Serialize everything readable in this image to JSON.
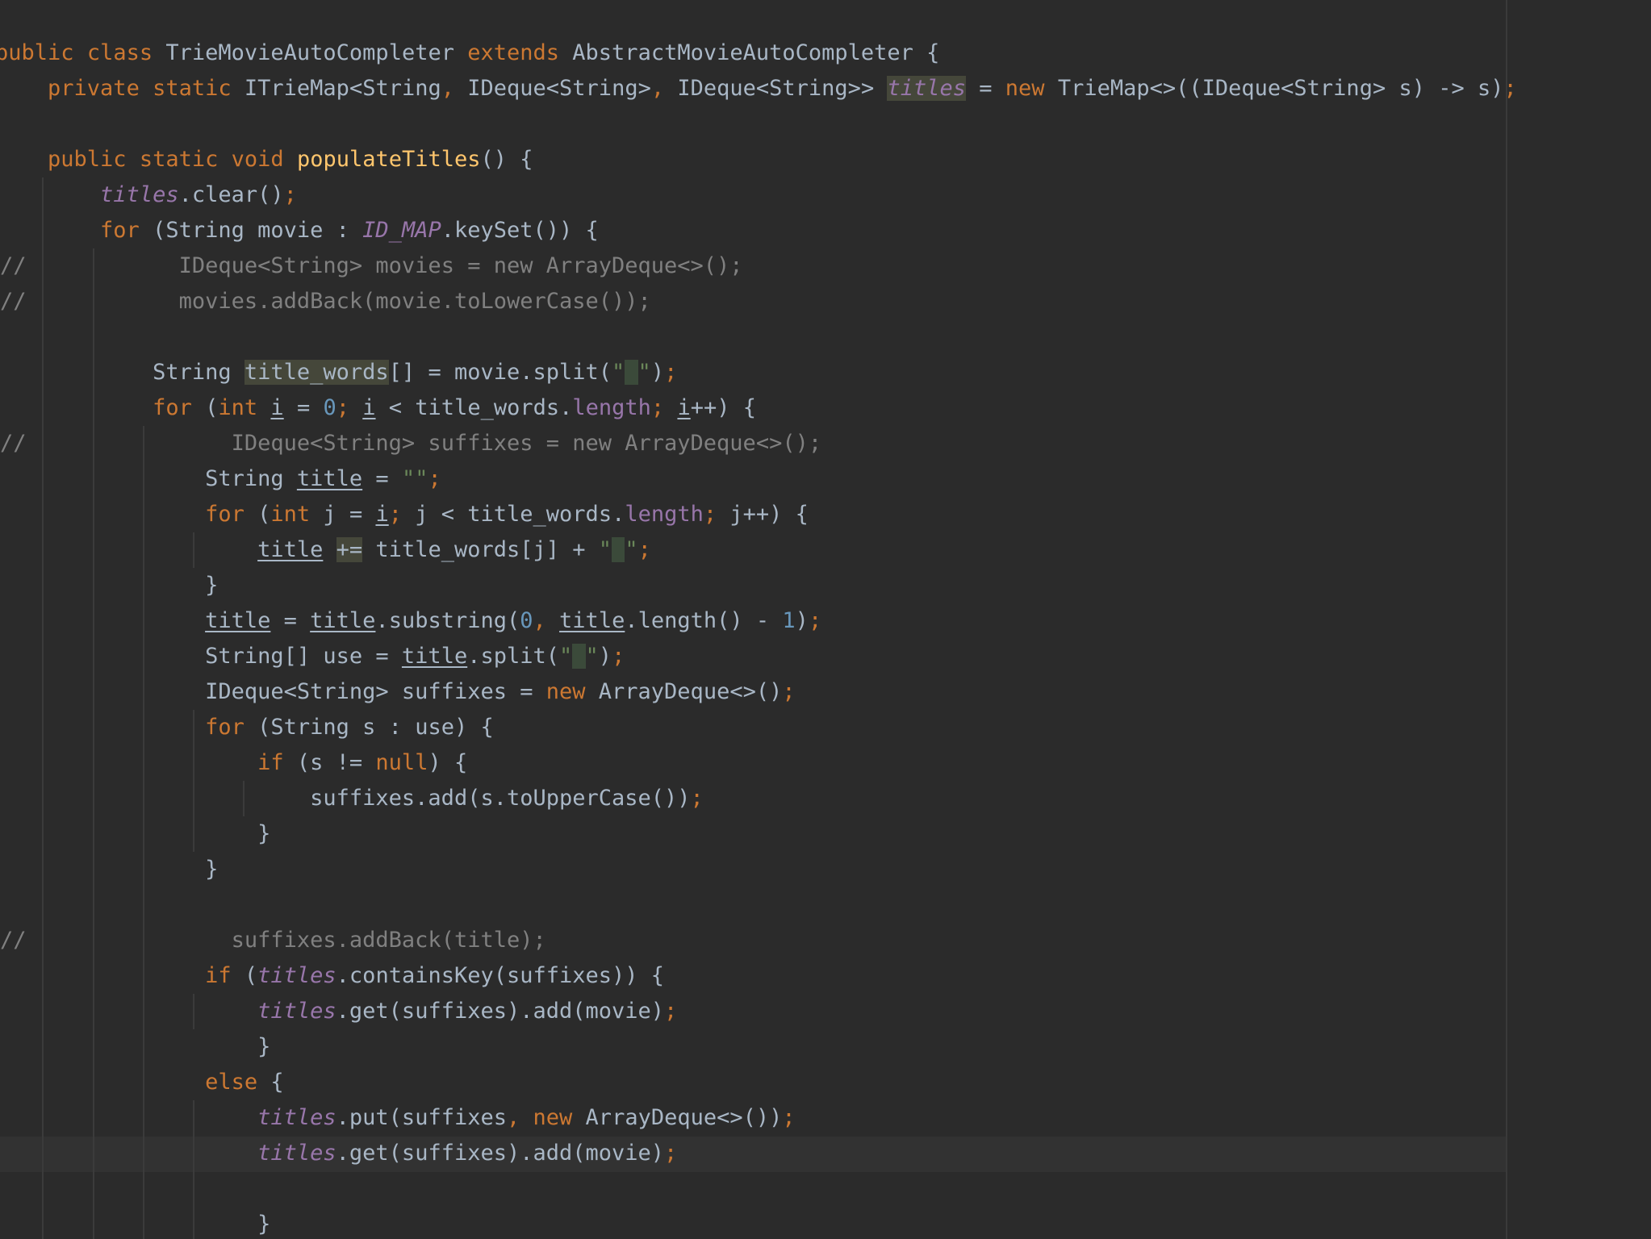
{
  "editor": {
    "language": "Java",
    "code_lines": [
      "public class TrieMovieAutoCompleter extends AbstractMovieAutoCompleter {",
      "    private static ITrieMap<String, IDeque<String>, IDeque<String>> titles = new TrieMap<>((IDeque<String> s) -> s);",
      "",
      "    public static void populateTitles() {",
      "        titles.clear();",
      "        for (String movie : ID_MAP.keySet()) {",
      "//            IDeque<String> movies = new ArrayDeque<>();",
      "//            movies.addBack(movie.toLowerCase());",
      "",
      "            String title_words[] = movie.split(\" \");",
      "            for (int i = 0; i < title_words.length; i++) {",
      "//                IDeque<String> suffixes = new ArrayDeque<>();",
      "                String title = \"\";",
      "                for (int j = i; j < title_words.length; j++) {",
      "                    title += title_words[j] + \" \";",
      "                }",
      "                title = title.substring(0, title.length() - 1);",
      "                String[] use = title.split(\" \");",
      "                IDeque<String> suffixes = new ArrayDeque<>();",
      "                for (String s : use) {",
      "                    if (s != null) {",
      "                        suffixes.add(s.toUpperCase());",
      "                    }",
      "                }",
      "",
      "//                suffixes.addBack(title);",
      "                if (titles.containsKey(suffixes)) {",
      "                    titles.get(suffixes).add(movie);",
      "                    }",
      "                else {",
      "                    titles.put(suffixes, new ArrayDeque<>());",
      "                    titles.get(suffixes).add(movie);",
      "",
      "                    }"
    ],
    "current_line": 32,
    "colors": {
      "background": "#2b2b2b",
      "keyword": "#cc7832",
      "field": "#9876aa",
      "method_decl": "#ffc66d",
      "number": "#6897bb",
      "string": "#6a8759",
      "comment": "#808080",
      "text": "#a9b7c6"
    }
  }
}
